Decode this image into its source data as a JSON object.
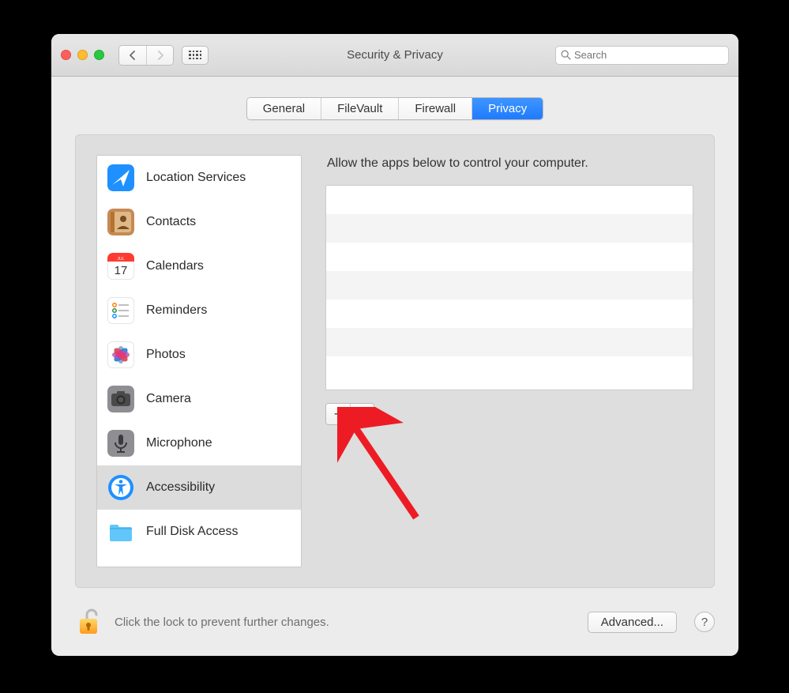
{
  "window": {
    "title": "Security & Privacy"
  },
  "search": {
    "placeholder": "Search"
  },
  "tabs": [
    {
      "label": "General",
      "active": false
    },
    {
      "label": "FileVault",
      "active": false
    },
    {
      "label": "Firewall",
      "active": false
    },
    {
      "label": "Privacy",
      "active": true
    }
  ],
  "sidebar": {
    "items": [
      {
        "label": "Location Services",
        "icon": "location-icon",
        "selected": false
      },
      {
        "label": "Contacts",
        "icon": "contacts-icon",
        "selected": false
      },
      {
        "label": "Calendars",
        "icon": "calendar-icon",
        "selected": false
      },
      {
        "label": "Reminders",
        "icon": "reminders-icon",
        "selected": false
      },
      {
        "label": "Photos",
        "icon": "photos-icon",
        "selected": false
      },
      {
        "label": "Camera",
        "icon": "camera-icon",
        "selected": false
      },
      {
        "label": "Microphone",
        "icon": "microphone-icon",
        "selected": false
      },
      {
        "label": "Accessibility",
        "icon": "accessibility-icon",
        "selected": true
      },
      {
        "label": "Full Disk Access",
        "icon": "folder-icon",
        "selected": false
      }
    ]
  },
  "pane": {
    "description": "Allow the apps below to control your computer.",
    "apps": []
  },
  "buttons": {
    "add": "+",
    "remove": "−",
    "advanced": "Advanced...",
    "help": "?"
  },
  "footer": {
    "lock_text": "Click the lock to prevent further changes."
  },
  "colors": {
    "accent": "#1f7bff",
    "annotation": "#ed1c24"
  }
}
